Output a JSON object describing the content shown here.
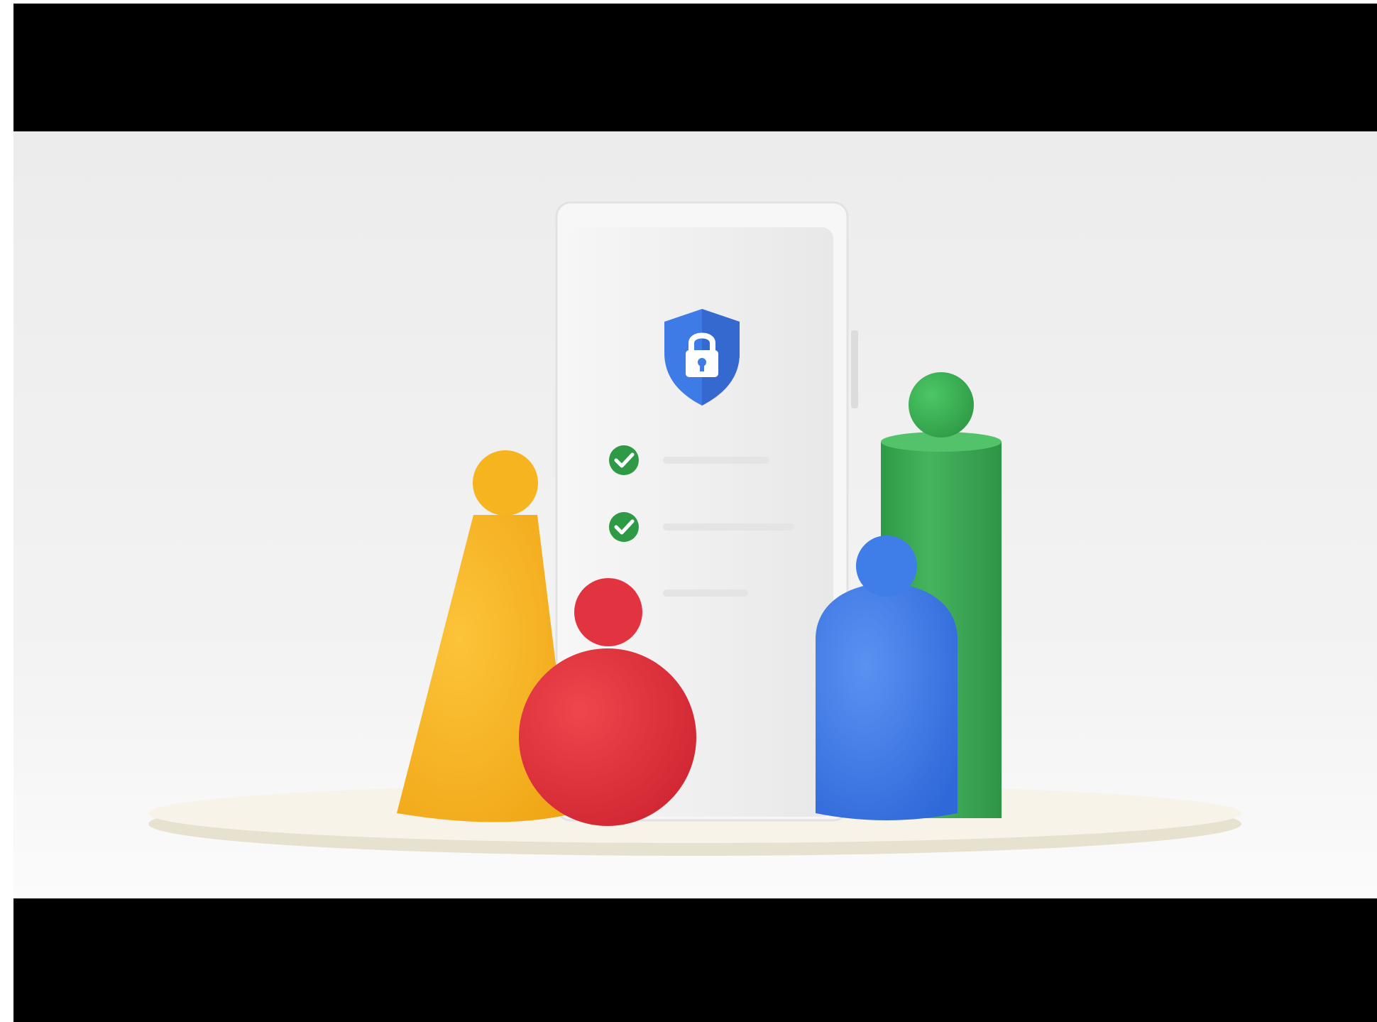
{
  "video": {
    "letterbox_color": "#000000",
    "scene_background": "#eeeeee"
  },
  "illustration": {
    "phone": {
      "shield_icon": "shield-lock-icon",
      "checklist": [
        {
          "status": "checked",
          "icon": "check-circle-icon"
        },
        {
          "status": "checked",
          "icon": "check-circle-icon"
        },
        {
          "status": "unchecked",
          "icon": "none"
        }
      ]
    },
    "figures": [
      {
        "shape": "cone",
        "color": "#f5b51c"
      },
      {
        "shape": "sphere",
        "color": "#e2323c"
      },
      {
        "shape": "dome",
        "color": "#3b78e7"
      },
      {
        "shape": "cylinder",
        "color": "#34a84f"
      }
    ],
    "brand_colors": {
      "blue": "#3b78e7",
      "red": "#e2323c",
      "yellow": "#f5b51c",
      "green": "#34a84f"
    }
  }
}
